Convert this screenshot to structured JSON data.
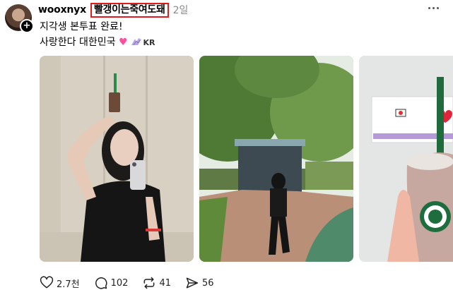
{
  "post": {
    "username": "wooxnyx",
    "tag": "빨갱이는죽여도돼",
    "time": "2일",
    "line1": "지각생 본투표 완료!",
    "line2": "사랑한다 대한민국",
    "heart": "♥",
    "kr": "KR"
  },
  "actions": {
    "likes": "2.7천",
    "comments": "102",
    "reposts": "41",
    "shares": "56"
  },
  "icons": [
    "more-icon",
    "plus-icon",
    "heart-icon",
    "comment-icon",
    "repost-icon",
    "share-icon"
  ]
}
